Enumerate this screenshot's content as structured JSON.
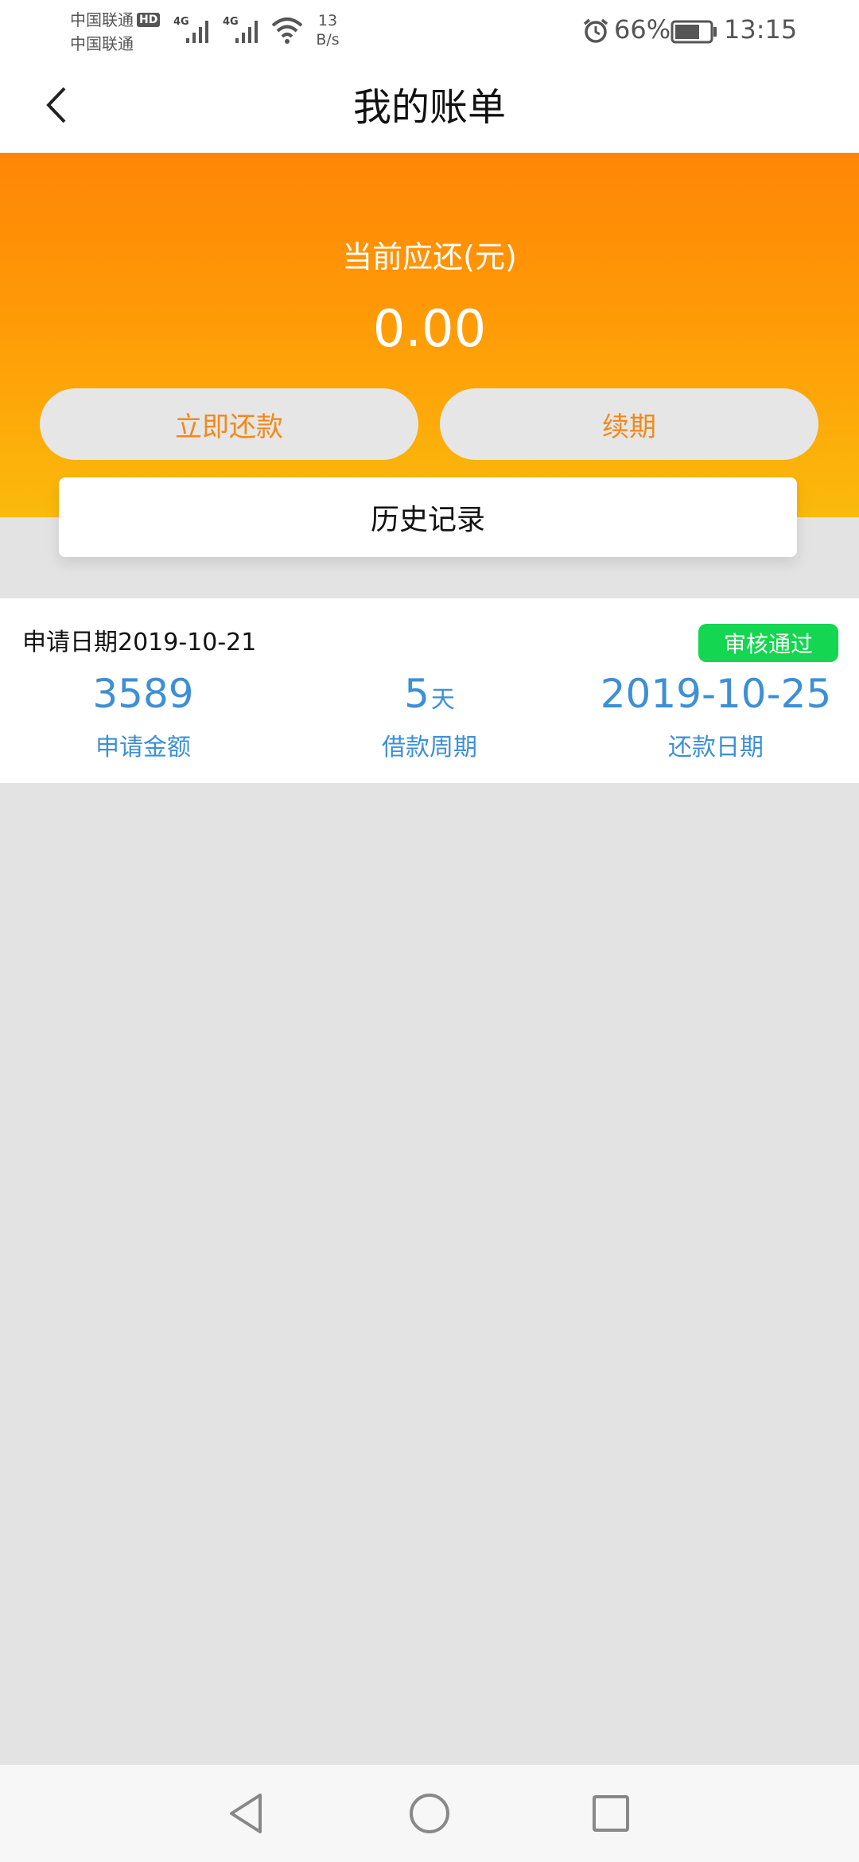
{
  "status_bar": {
    "carrier_1": "中国联通",
    "carrier_1_badge": "HD",
    "carrier_2": "中国联通",
    "network_1": "4G",
    "network_2": "4G",
    "net_speed_value": "13",
    "net_speed_unit": "B/s",
    "battery_percent": "66%",
    "time": "13:15"
  },
  "navbar": {
    "title": "我的账单",
    "back_icon": "chevron-left-icon"
  },
  "hero": {
    "label": "当前应还(元)",
    "amount": "0.00",
    "repay_button": "立即还款",
    "renew_button": "续期",
    "history_button": "历史记录"
  },
  "record": {
    "apply_date": "申请日期2019-10-21",
    "status": "审核通过",
    "amount_value": "3589",
    "amount_label": "申请金额",
    "period_value": "5",
    "period_unit": "天",
    "period_label": "借款周期",
    "repay_date_value": "2019-10-25",
    "repay_date_label": "还款日期"
  },
  "colors": {
    "orange_top": "#ff8606",
    "orange_bottom": "#fbba0c",
    "button_text": "#f08a1c",
    "accent_blue": "#3d8fd6",
    "status_green": "#14d650",
    "page_bg": "#e3e3e3"
  },
  "system_nav": {
    "back_icon": "triangle-back-icon",
    "home_icon": "circle-home-icon",
    "recent_icon": "square-recents-icon"
  }
}
